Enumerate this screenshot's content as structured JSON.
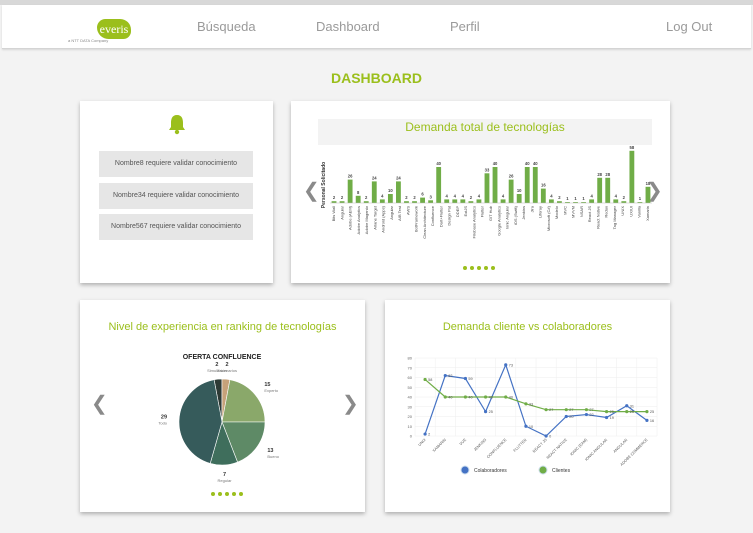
{
  "nav": {
    "logo_word": "everis",
    "logo_sub": "a NTT DATA Company",
    "busqueda": "Búsqueda",
    "dashboard": "Dashboard",
    "perfil": "Perfil",
    "logout": "Log Out"
  },
  "page": {
    "title": "DASHBOARD"
  },
  "notifications": {
    "items": [
      "Nombre8 requiere validar conocimiento",
      "Nombre34 requiere validar conocimiento",
      "Nombre567 requiere validar conocimiento"
    ]
  },
  "demand_card": {
    "title": "Demanda total de tecnologías"
  },
  "experience_card": {
    "title": "Nivel de experiencia en ranking de tecnologías"
  },
  "client_card": {
    "title": "Demanda cliente vs colaboradores"
  },
  "colors": {
    "brand_green": "#9bbf1c",
    "bar_green": "#70ad47",
    "line_blue": "#4472c4"
  },
  "chart_data": [
    {
      "type": "bar",
      "title": "Demanda total de tecnologías",
      "ylabel": "Personal Solicitado",
      "categories": [
        "Bits Wall",
        "Angular",
        "Adobe (AEM)",
        "Adobe Analytics",
        "Adobe Magento",
        "Ariane Target",
        "Android (Apps)",
        "Angular",
        "A/B Test",
        "AWS",
        "BotFramework",
        "Clean Architecture",
        "Confluence",
        "Dart+Flutter",
        "Design Pat",
        "DDEP",
        "ExtJS",
        "Firebase Analytics",
        "Flutter",
        "GIT Hub",
        "Google Analytics",
        "Ionic Angular",
        "iOS (Swift)",
        "Jenkins",
        "Jira",
        "Liferay",
        "Microsoft (C#)",
        "Modelo",
        "MVC",
        "MVVM",
        "NSAR",
        "React JS",
        "React Native",
        "Redux",
        "Tag Manager",
        "UNIX",
        "UX/UI",
        "Vanilla",
        "Xamarin"
      ],
      "values": [
        2,
        2,
        26,
        8,
        2,
        24,
        4,
        10,
        24,
        2,
        2,
        6,
        3,
        40,
        4,
        4,
        4,
        2,
        4,
        33,
        40,
        4,
        26,
        10,
        40,
        40,
        16,
        4,
        2,
        1,
        1,
        1,
        4,
        28,
        28,
        4,
        2,
        58,
        1,
        18
      ],
      "ylim": [
        0,
        60
      ]
    },
    {
      "type": "pie",
      "title": "OFERTA CONFLUENCE",
      "slices": [
        {
          "label": "Simulación",
          "value": 2,
          "color": "#2d3a35"
        },
        {
          "label": "Escenarios",
          "value": 2,
          "color": "#c6a27a"
        },
        {
          "label": "Experto",
          "value": 15,
          "color": "#8aa86a"
        },
        {
          "label": "Bueno",
          "value": 13,
          "color": "#5e8a66"
        },
        {
          "label": "Regular",
          "value": 7,
          "color": "#3f6e5c"
        },
        {
          "label": "Todo",
          "value": 29,
          "color": "#365b5b"
        }
      ]
    },
    {
      "type": "line",
      "title": "Demanda cliente vs colaboradores",
      "categories": [
        "UNIX",
        "XAMARIN",
        "VUE",
        "JENKINS",
        "CONFLUENCE",
        "FLUTTER",
        "REACT JS",
        "REACT NATIVE",
        "IONIC (EAM)",
        "IONIC ANGULAR",
        "ANGULAR",
        "ADOBE COMMERCE"
      ],
      "series": [
        {
          "name": "Colaboradores",
          "values": [
            2,
            62,
            59,
            25,
            73,
            10,
            0,
            20,
            22,
            19,
            31,
            16
          ],
          "color": "#4472c4"
        },
        {
          "name": "Clientes",
          "values": [
            58,
            40,
            40,
            40,
            40,
            33,
            27,
            27,
            27,
            25,
            25,
            25
          ],
          "color": "#70ad47"
        }
      ],
      "ylim": [
        0,
        80
      ],
      "yticks": [
        0,
        10,
        20,
        30,
        40,
        50,
        60,
        70,
        80
      ]
    }
  ]
}
